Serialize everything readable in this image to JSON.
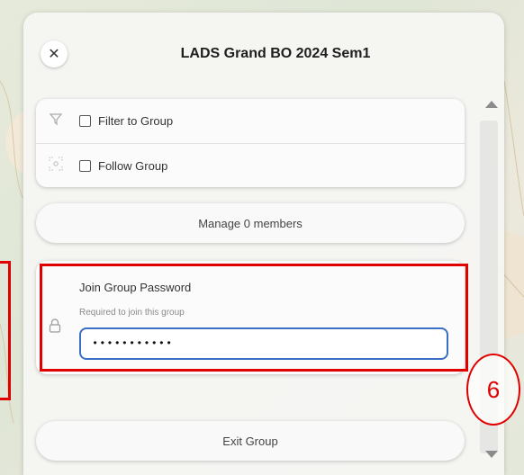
{
  "dialog": {
    "title": "LADS Grand BO 2024 Sem1",
    "close_icon": "close-icon"
  },
  "options": {
    "filter_label": "Filter to Group",
    "filter_checked": false,
    "follow_label": "Follow Group",
    "follow_checked": false
  },
  "manage_label": "Manage 0 members",
  "password": {
    "title": "Join Group Password",
    "hint": "Required to join this group",
    "value": "•••••••••••"
  },
  "exit_label": "Exit Group",
  "annotation": {
    "number": "6",
    "color": "#e00000"
  },
  "colors": {
    "input_focus": "#3a6fc4"
  }
}
